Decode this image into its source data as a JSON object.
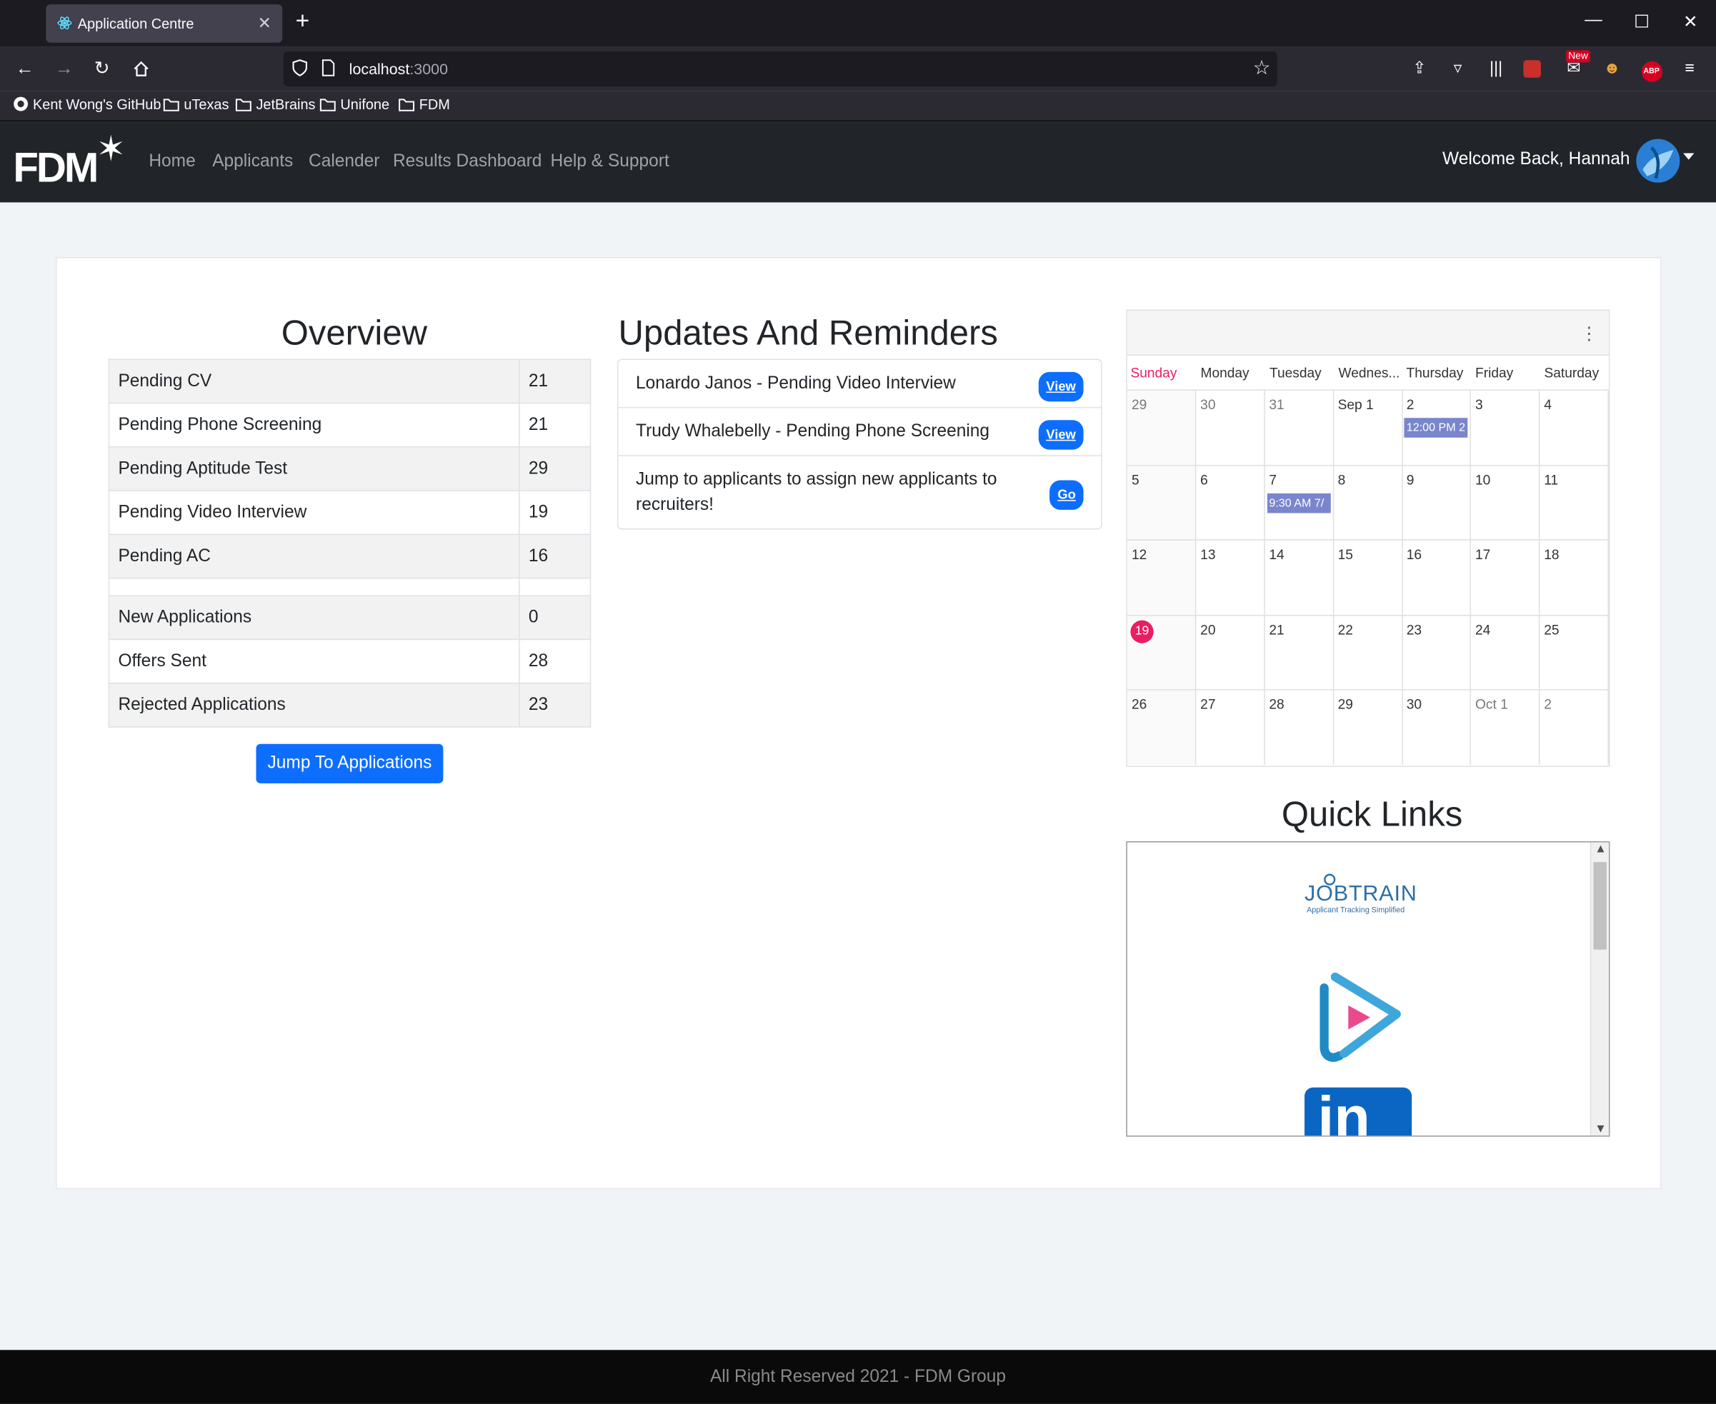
{
  "browser": {
    "tab_title": "Application Centre",
    "url_host": "localhost",
    "url_port": ":3000",
    "bookmarks": [
      "Kent Wong's GitHub",
      "uTexas",
      "JetBrains",
      "Unifone",
      "FDM"
    ],
    "new_badge": "New",
    "abp_label": "ABP"
  },
  "app": {
    "logo_text": "FDM",
    "nav": [
      "Home",
      "Applicants",
      "Calender",
      "Results Dashboard",
      "Help & Support"
    ],
    "welcome": "Welcome Back, Hannah"
  },
  "overview": {
    "title": "Overview",
    "rows": [
      {
        "label": "Pending CV",
        "value": "21"
      },
      {
        "label": "Pending Phone Screening",
        "value": "21"
      },
      {
        "label": "Pending Aptitude Test",
        "value": "29"
      },
      {
        "label": "Pending Video Interview",
        "value": "19"
      },
      {
        "label": "Pending AC",
        "value": "16"
      },
      {
        "label": "New Applications",
        "value": "0"
      },
      {
        "label": "Offers Sent",
        "value": "28"
      },
      {
        "label": "Rejected Applications",
        "value": "23"
      }
    ],
    "button": "Jump To Applications"
  },
  "updates": {
    "title": "Updates And Reminders",
    "items": [
      {
        "text": "Lonardo Janos - Pending Video Interview",
        "action": "View"
      },
      {
        "text": "Trudy Whalebelly - Pending Phone Screening",
        "action": "View"
      },
      {
        "text": "Jump to applicants to assign new applicants to recruiters!",
        "action": "Go"
      }
    ]
  },
  "calendar": {
    "weekdays": [
      "Sunday",
      "Monday",
      "Tuesday",
      "Wednes...",
      "Thursday",
      "Friday",
      "Saturday"
    ],
    "weeks": [
      [
        "29",
        "30",
        "31",
        "Sep 1",
        "2",
        "3",
        "4"
      ],
      [
        "5",
        "6",
        "7",
        "8",
        "9",
        "10",
        "11"
      ],
      [
        "12",
        "13",
        "14",
        "15",
        "16",
        "17",
        "18"
      ],
      [
        "19",
        "20",
        "21",
        "22",
        "23",
        "24",
        "25"
      ],
      [
        "26",
        "27",
        "28",
        "29",
        "30",
        "Oct 1",
        "2"
      ]
    ],
    "events": {
      "thu_2": "12:00 PM 2",
      "tue_7": "9:30 AM 7/"
    }
  },
  "quick_links": {
    "title": "Quick Links",
    "jobtrain_text": "JOBTRAIN",
    "jobtrain_tagline": "Applicant Tracking Simplified",
    "linkedin_text": "in"
  },
  "footer": "All Right Reserved 2021 - FDM Group",
  "colors": {
    "accent": "#0d6efd",
    "today": "#e91e63",
    "event": "#7986cb",
    "navbar": "#212529"
  }
}
